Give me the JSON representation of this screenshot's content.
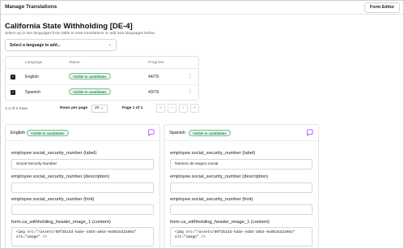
{
  "app": {
    "title": "Manage Translations",
    "form_editor_label": "Form Editor"
  },
  "page": {
    "title": "California State Withholding [DE-4]",
    "subtitle": "Select up to two languages from table to view translations or add new languages below."
  },
  "language_select": {
    "placeholder": "Select a language to add...",
    "icon": "chevron-up-down-icon"
  },
  "table": {
    "headers": {
      "language": "Language",
      "status": "Status",
      "progress": "Progress"
    },
    "rows": [
      {
        "language": "English",
        "status": "Visible to candidates",
        "progress": "44/79",
        "checked": true
      },
      {
        "language": "Spanish",
        "status": "Visible to candidates",
        "progress": "43/79",
        "checked": true
      }
    ]
  },
  "pagination": {
    "count": "1-2 of 2 rows",
    "rows_per_page_label": "Rows per page",
    "rows_per_page_value": "20",
    "page_of": "Page 1 of 1",
    "first": "«",
    "prev": "‹",
    "next": "›",
    "last": "»"
  },
  "panels": [
    {
      "language": "English",
      "status": "Visible to candidates",
      "fields": {
        "label_key": "employee.social_security_number (label)",
        "label_value": "Social Security Number",
        "description_key": "employee.social_security_number (description)",
        "description_value": "",
        "hint_key": "employee.social_security_number (hint)",
        "hint_value": "",
        "content_key": "form.ca_withholding_header_image_1 (content)",
        "content_value": "<img src=\"/assets/50f3b1dd-5abe-44b6-a8b4-9a9b3ad2a98a\" alt=\"image\" />"
      }
    },
    {
      "language": "Spanish",
      "status": "Visible to candidates",
      "fields": {
        "label_key": "employee.social_security_number (label)",
        "label_value": "Número de seguro social",
        "description_key": "employee.social_security_number (description)",
        "description_value": "",
        "hint_key": "employee.social_security_number (hint)",
        "hint_value": "",
        "content_key": "form.ca_withholding_header_image_1 (content)",
        "content_value": "<img src=\"/assets/50f3b1dd-5abe-44b6-a8b4-9a9b3ad2a98a\" alt=\"image\" />"
      }
    }
  ],
  "colors": {
    "badge_border": "#6fc08c",
    "badge_text": "#27894c",
    "chat_icon": "#a855f7"
  }
}
